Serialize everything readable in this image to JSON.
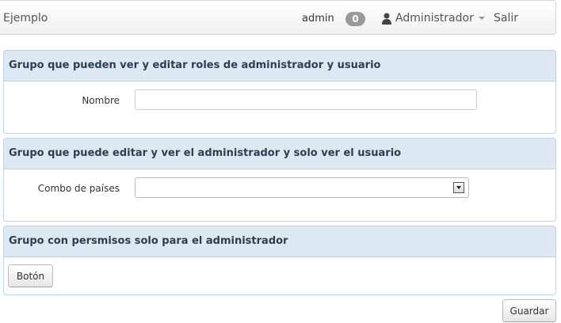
{
  "navbar": {
    "brand": "Ejemplo",
    "user": "admin",
    "badge_count": "0",
    "role_menu": "Administrador",
    "logout": "Salir",
    "icons": {
      "user": "person-icon",
      "menu": "caret-down-icon"
    }
  },
  "panels": [
    {
      "title": "Grupo que pueden ver y editar roles de administrador y usuario",
      "field_label": "Nombre",
      "field_value": "",
      "field_placeholder": ""
    },
    {
      "title": "Grupo que puede editar y ver el administrador y solo ver el usuario",
      "field_label": "Combo de países",
      "selected_value": ""
    },
    {
      "title": "Grupo con persmisos solo para el administrador",
      "button_label": "Botón"
    }
  ],
  "footer": {
    "save_label": "Guardar"
  },
  "colors": {
    "panel_heading_bg": "#dde8f3",
    "panel_border": "#bcd4e6",
    "badge_bg": "#999999"
  }
}
